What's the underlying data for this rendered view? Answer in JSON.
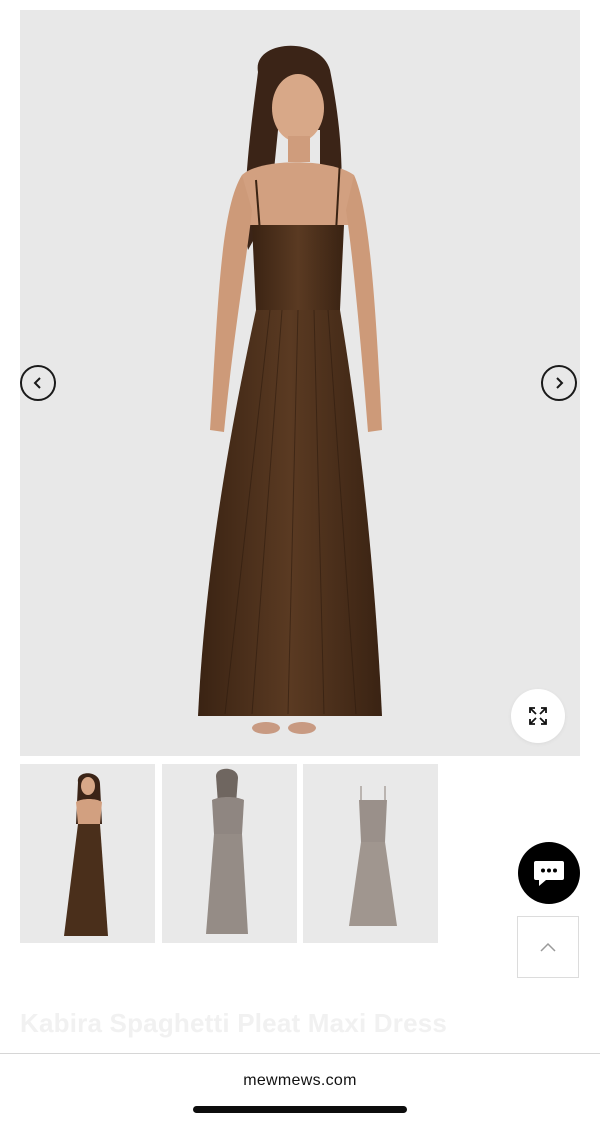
{
  "product": {
    "title": "Kabira Spaghetti Pleat Maxi Dress"
  },
  "gallery": {
    "prev_icon": "chevron-left-icon",
    "next_icon": "chevron-right-icon",
    "zoom_icon": "expand-arrows-icon",
    "thumbnails": [
      {
        "label": "front view brown",
        "selected": true
      },
      {
        "label": "back view",
        "selected": false
      },
      {
        "label": "flat lay",
        "selected": false
      }
    ]
  },
  "floating": {
    "chat_icon": "chat-bubble-icon",
    "top_icon": "chevron-up-icon"
  },
  "browser": {
    "url": "mewmews.com"
  },
  "colors": {
    "image_bg": "#e8e8e8",
    "dress_brown": "#4a2f1b",
    "thumb_gray": "#8f8681",
    "chat_bg": "#000000"
  }
}
